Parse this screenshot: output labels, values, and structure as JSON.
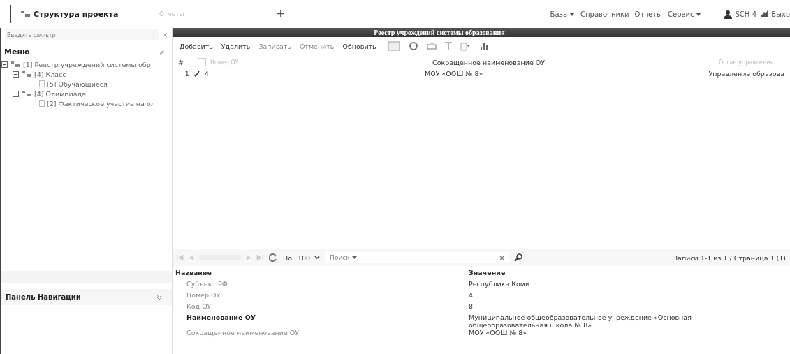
{
  "tabs": [
    {
      "label": "Структура проекта",
      "selected": true
    },
    {
      "label": "Отчеты",
      "selected": false
    }
  ],
  "add_tab": "+",
  "menu": [
    {
      "label": "База",
      "dropdown": true
    },
    {
      "label": "Справочники",
      "dropdown": false
    },
    {
      "label": "Отчеты",
      "dropdown": false
    },
    {
      "label": "Сервис",
      "dropdown": true
    }
  ],
  "user": "SCH-4",
  "logout": "Выхо",
  "sidebar": {
    "filter_placeholder": "Введите фильтр",
    "menu_title": "Меню",
    "tree": [
      {
        "label": "[1] Реестр учреждений системы обр",
        "expanded": true,
        "children": [
          {
            "label": "[4] Класс",
            "expanded": true,
            "children": [
              {
                "label": "[5] Обучающиеся"
              }
            ]
          },
          {
            "label": "[4] Олимпиада",
            "expanded": true,
            "children": [
              {
                "label": "[2] Фактическое участие на ол"
              }
            ]
          }
        ]
      }
    ],
    "nav_panel": "Панель Навигации"
  },
  "panel_title": "Реестр учреждений системы образования",
  "toolbar": [
    {
      "label": "Добавить",
      "disabled": false
    },
    {
      "label": "Удалить",
      "disabled": false
    },
    {
      "label": "Записать",
      "disabled": true
    },
    {
      "label": "Отменить",
      "disabled": true
    },
    {
      "label": "Обновить",
      "disabled": false
    }
  ],
  "table": {
    "select_all_checked": false,
    "columns": [
      "#",
      "Номер ОУ",
      "Сокращенное наименование ОУ",
      "Орган управления"
    ],
    "rows": [
      {
        "cells": [
          "1",
          "4",
          "МОУ «ООШ № 8»",
          "Управление образова"
        ],
        "checked": true
      }
    ]
  },
  "paging": {
    "per_page_label": "По",
    "per_page": "100",
    "search_placeholder": "Поиск",
    "summary": "Записи 1-1 из 1 / Страница 1 (1)"
  },
  "properties": {
    "columns": [
      "Название",
      "Значение"
    ],
    "rows": [
      {
        "name": "Субъект РФ",
        "value": "Республика Коми",
        "required": false
      },
      {
        "name": "Номер ОУ",
        "value": "4",
        "required": false
      },
      {
        "name": "Код ОУ",
        "value": "8",
        "required": false
      },
      {
        "name": "Наименование ОУ",
        "value": "Муниципальное общеобразовательное учреждение «Основная общеобразовательная школа № 8»",
        "required": true
      },
      {
        "name": "Сокращенное наименование ОУ",
        "value": "МОУ «ООШ № 8»",
        "required": false
      }
    ]
  }
}
